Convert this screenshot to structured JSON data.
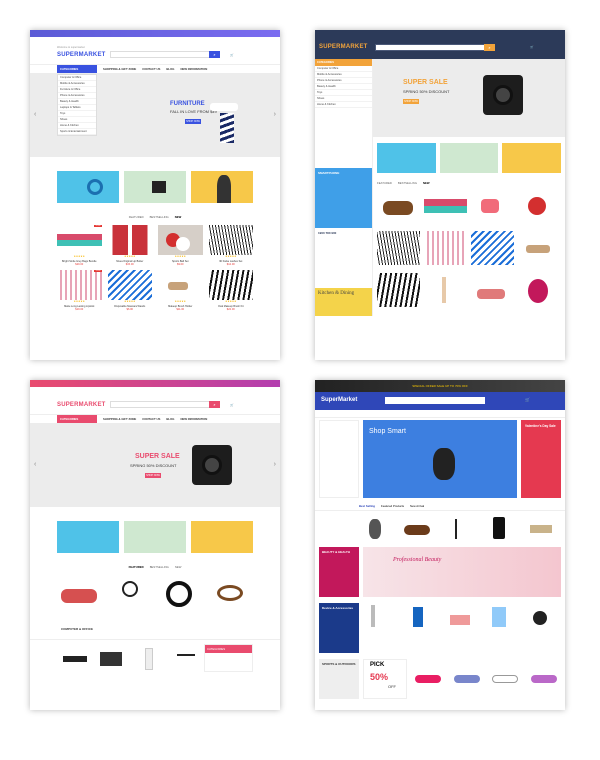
{
  "store_name": "SUPERMARKET",
  "store_name_alt": "SuperMarket",
  "p1": {
    "logo": "SUPERMARKET",
    "tagline": "Welcome to supermarket",
    "search_btn": "⌕",
    "nav": [
      "SHOPPING & GIFT ZONE",
      "CONTACT US",
      "BLOG",
      "NEW INFORMATION"
    ],
    "categories_label": "CATEGORIES",
    "categories": [
      "Computer & Office",
      "Mobile & Accessories",
      "Furniture & Office",
      "Phone & Accessories",
      "Beauty & Health",
      "Laptops & Tablets",
      "Toys",
      "Shoes",
      "Home & Kitchen",
      "Sports & Entertainment"
    ],
    "hero": {
      "title": "FURNITURE",
      "subtitle": "FALL IN LOVE FROM $49",
      "button": "SHOP NOW"
    },
    "tabs": [
      "FEATURED",
      "BESTSELLING",
      "NEW"
    ],
    "products": [
      {
        "name": "Bright Smile Grey Bags Bundle",
        "price": "$29.00",
        "old": "$35.00",
        "badge": "-15%"
      },
      {
        "name": "Nivea Original Lip Butter",
        "price": "$15.00",
        "old": "$20.00",
        "badge": ""
      },
      {
        "name": "Sports Ball Set",
        "price": "$9.00",
        "old": "",
        "badge": ""
      },
      {
        "name": "3D False Lashes Set",
        "price": "$12.00",
        "old": "",
        "badge": ""
      },
      {
        "name": "Matte Long Lasting Lipstick",
        "price": "$19.00",
        "old": "$24.00",
        "badge": "-10%"
      },
      {
        "name": "Disposable Mascara Wands",
        "price": "$6.00",
        "old": "",
        "badge": ""
      },
      {
        "name": "Makeup Brush Holder",
        "price": "$11.00",
        "old": "",
        "badge": ""
      },
      {
        "name": "Oval Makeup Brush Kit",
        "price": "$22.00",
        "old": "$28.00",
        "badge": ""
      }
    ]
  },
  "p2": {
    "logo": "SUPERMARKET",
    "search_btn": "⌕",
    "categories_label": "CATEGORIES",
    "categories": [
      "Computer & Office",
      "Mobile & Accessories",
      "Phone & Accessories",
      "Beauty & Health",
      "Toys",
      "Shoes",
      "Home & Kitchen"
    ],
    "hero": {
      "title": "SUPER SALE",
      "subtitle": "SPRING 50% DISCOUNT",
      "button": "SHOP NOW"
    },
    "tabs": [
      "FEATURED",
      "BESTSELLING",
      "NEW"
    ],
    "side_banner": "SMARTPHONE",
    "side_banner2": "Kitchen & Dining",
    "hotline": "1900 780 900"
  },
  "p3": {
    "logo": "SUPERMARKET",
    "search_btn": "⌕",
    "categories_label": "CATEGORIES",
    "nav": [
      "SHOPPING & GIFT ZONE",
      "CONTACT US",
      "BLOG",
      "NEW INFORMATION"
    ],
    "hero": {
      "title": "SUPER SALE",
      "subtitle": "SPRING 50% DISCOUNT",
      "button": "SHOP NOW"
    },
    "tabs": [
      "FEATURED",
      "BESTSELLING",
      "NEW"
    ],
    "section2": "COMPUTER & OFFICE",
    "section2_cat": "CATEGORIES"
  },
  "p4": {
    "logo": "SuperMarket",
    "top_banner": "SPECIAL OFFER SALE UP TO 70% OFF",
    "hero_title": "Shop Smart",
    "hero_sub": "Valentine's Day Sale",
    "tabs": [
      "Best Selling",
      "Featured Products",
      "New Arrival"
    ],
    "beauty": "BEAUTY & HEALTH",
    "professional": "Professional Beauty",
    "device": "Device & Accessories",
    "sports": "SPORTS & OUTDOORS",
    "pick": "PICK",
    "pick_pct": "50%",
    "pick_sub": "OFF"
  },
  "colors": {
    "p1": "#4a5ee8",
    "p2": "#2c3a59",
    "p3": "#ea4d6f",
    "p4": "#2f47b8",
    "orange": "#ff8f00",
    "accent": "#f2a33a"
  }
}
